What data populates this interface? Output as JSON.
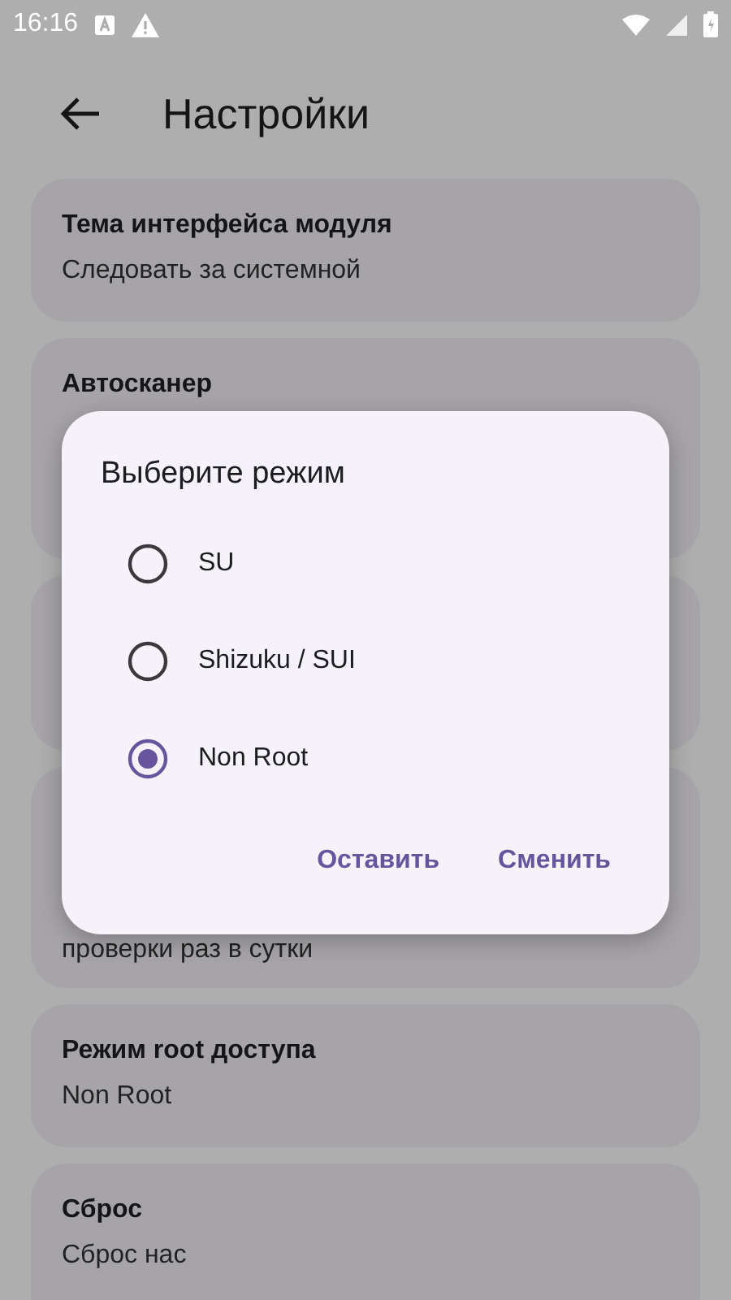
{
  "status_bar": {
    "time": "16:16"
  },
  "app_bar": {
    "title": "Настройки"
  },
  "settings": [
    {
      "kind": "card",
      "title": "Тема интерфейса модуля",
      "lines": [
        "Следовать за системной"
      ]
    },
    {
      "kind": "card",
      "title": "Автосканер"
    },
    {
      "kind": "card"
    },
    {
      "kind": "card",
      "lines": [
        "проверки раз в сутки"
      ]
    },
    {
      "kind": "card",
      "title": "Режим root доступа",
      "lines": [
        "Non Root"
      ]
    },
    {
      "kind": "card",
      "title": "Сброс",
      "lines": [
        "Сброс нас"
      ]
    }
  ],
  "dialog": {
    "title": "Выберите режим",
    "options": [
      {
        "label": "SU",
        "selected": false
      },
      {
        "label": "Shizuku / SUI",
        "selected": false
      },
      {
        "label": "Non Root",
        "selected": true
      }
    ],
    "buttons": [
      "Оставить",
      "Сменить"
    ]
  }
}
